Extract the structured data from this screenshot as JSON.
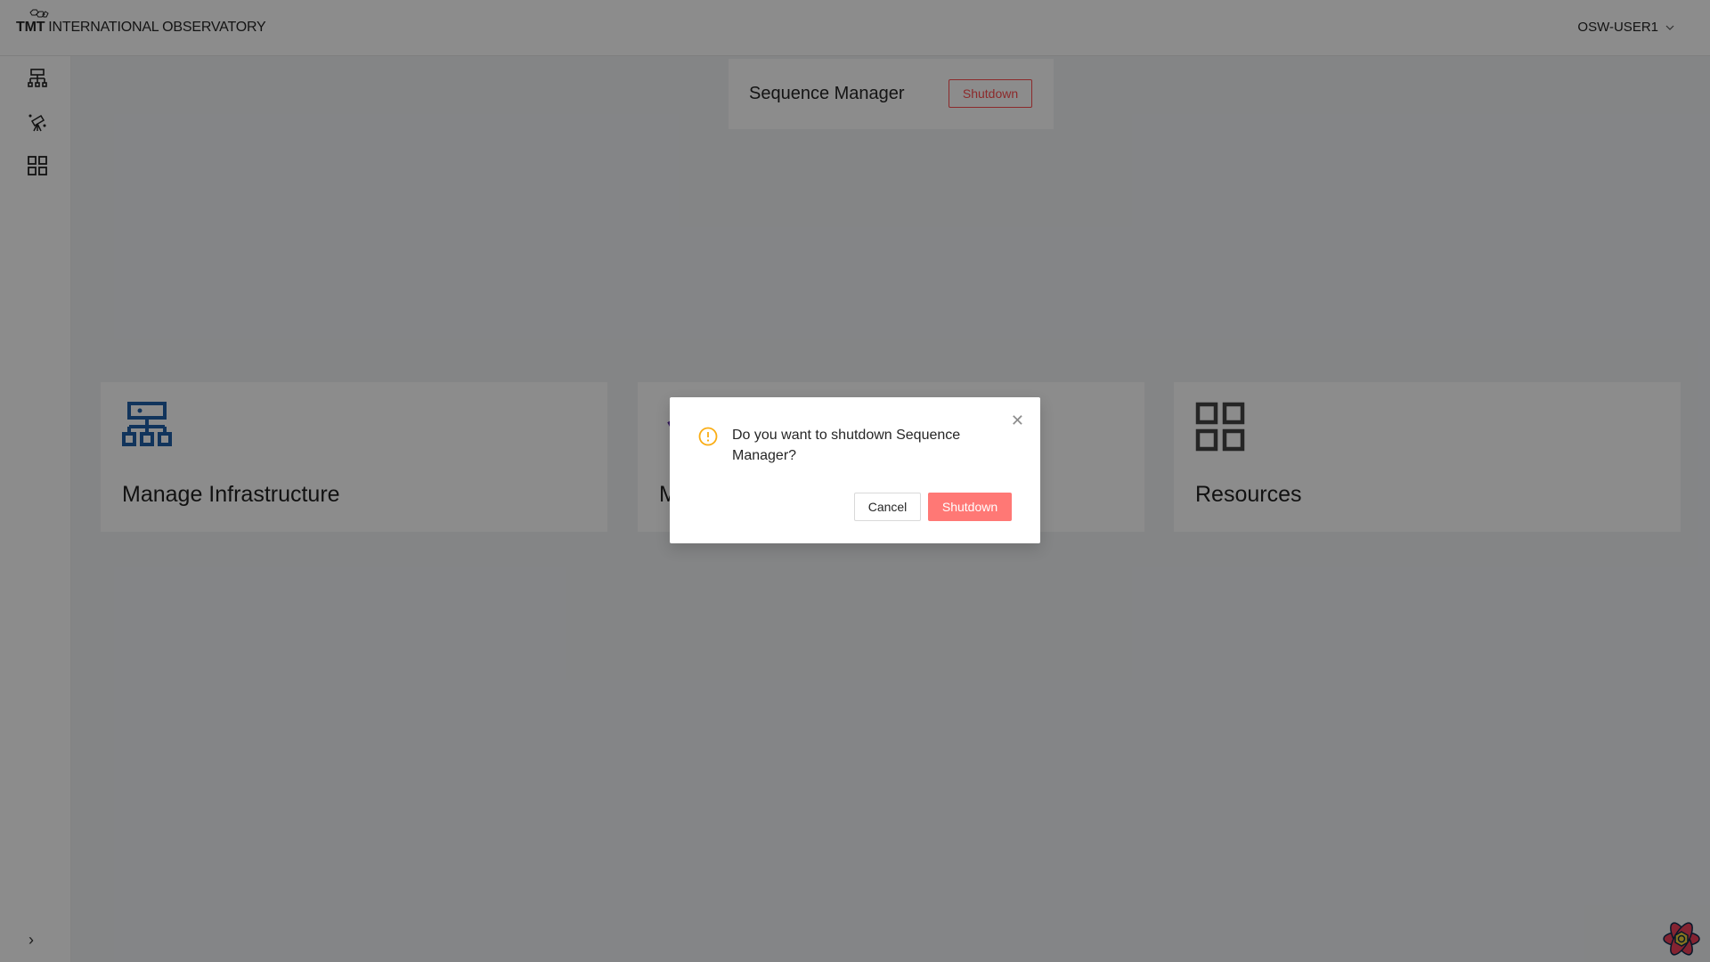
{
  "header": {
    "logo_mark": "TMT",
    "logo_text": "INTERNATIONAL OBSERVATORY",
    "user": "OSW-USER1"
  },
  "sidebar": {
    "items": [
      {
        "icon": "network-icon"
      },
      {
        "icon": "telescope-icon"
      },
      {
        "icon": "grid-icon"
      }
    ],
    "collapse_icon": "chevron-right-icon"
  },
  "top_card": {
    "title": "Sequence Manager",
    "button": "Shutdown"
  },
  "cards": [
    {
      "title": "Manage Infrastructure",
      "icon": "network-icon",
      "color": "#1f5fa8"
    },
    {
      "title": "M",
      "icon": "telescope-icon",
      "color": "#5b2ca0"
    },
    {
      "title": "Resources",
      "icon": "grid-icon",
      "color": "#444444"
    }
  ],
  "modal": {
    "message": "Do you want to shutdown Sequence Manager?",
    "cancel": "Cancel",
    "ok": "Shutdown",
    "warn_color": "#faad14",
    "ok_color": "#ff7875"
  }
}
